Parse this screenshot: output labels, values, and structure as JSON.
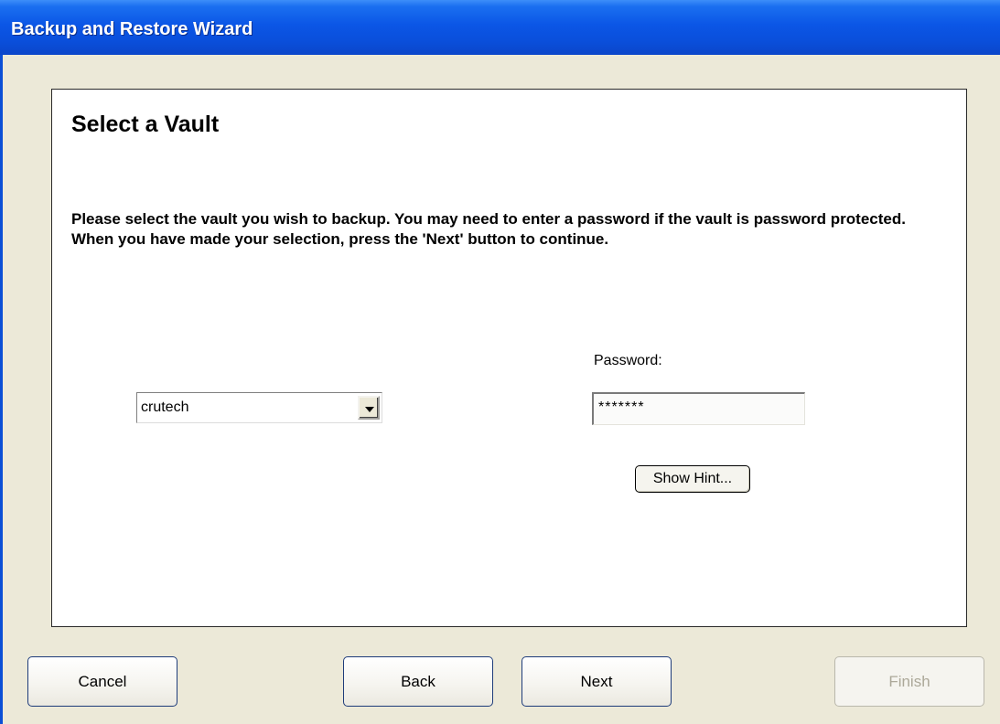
{
  "window": {
    "title": "Backup and Restore Wizard"
  },
  "page": {
    "heading": "Select a Vault",
    "instructions": "Please select the vault you wish to backup. You may need to enter a password if the vault is password protected. When you have made your selection, press the 'Next' button to continue."
  },
  "vault_select": {
    "value": "crutech",
    "icon": "chevron-down-icon"
  },
  "password": {
    "label": "Password:",
    "value": "*******"
  },
  "buttons": {
    "show_hint": "Show Hint...",
    "cancel": "Cancel",
    "back": "Back",
    "next": "Next",
    "finish": "Finish"
  },
  "colors": {
    "titlebar": "#0b56e6",
    "window_bg": "#ece9d8",
    "disabled_text": "#aca899"
  }
}
